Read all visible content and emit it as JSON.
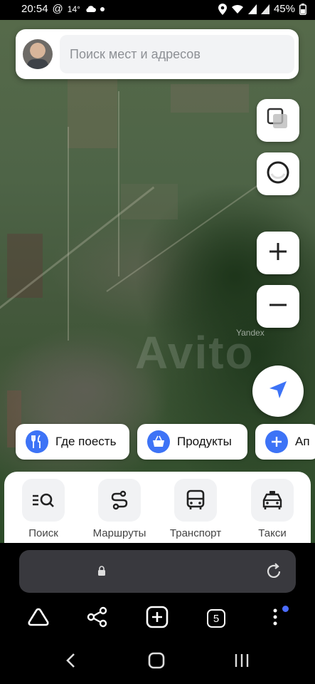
{
  "status_bar": {
    "time": "20:54",
    "at_icon": "@",
    "temperature": "14°",
    "weather_icon": "cloud-icon",
    "battery": "45%"
  },
  "search": {
    "placeholder": "Поиск мест и адресов"
  },
  "map": {
    "watermark": "Avito",
    "provider_label": "Yandex"
  },
  "map_controls": {
    "layers_icon": "layers-icon",
    "alice_icon": "alice-icon",
    "zoom_in_icon": "plus-icon",
    "zoom_out_icon": "minus-icon",
    "locate_icon": "navigation-arrow-icon"
  },
  "chips": [
    {
      "label": "Где поесть",
      "icon": "fork-knife-icon"
    },
    {
      "label": "Продукты",
      "icon": "basket-icon"
    },
    {
      "label": "Ап",
      "icon": "plus-icon"
    }
  ],
  "bottom_nav": [
    {
      "label": "Поиск",
      "icon": "search-list-icon"
    },
    {
      "label": "Маршруты",
      "icon": "route-icon"
    },
    {
      "label": "Транспорт",
      "icon": "bus-icon"
    },
    {
      "label": "Такси",
      "icon": "taxi-icon"
    }
  ],
  "browser": {
    "tabs_count": "5"
  },
  "colors": {
    "accent_blue": "#3d73f6",
    "notification_dot": "#4b6cff"
  }
}
